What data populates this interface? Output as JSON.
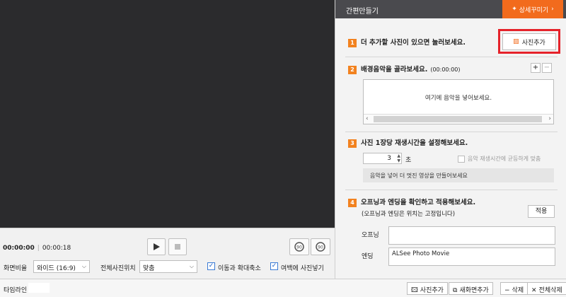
{
  "player": {
    "current_time": "00:00:00",
    "total_time": "00:00:18"
  },
  "options": {
    "aspect_label": "화면비율",
    "aspect_value": "와이드 (16:9)",
    "position_label": "전체사진위치",
    "position_value": "맞춤",
    "zoom_label": "이동과 확대축소",
    "zoom_checked": true,
    "margin_label": "여백에 사진넣기",
    "margin_checked": true
  },
  "timeline": {
    "label": "타임라인",
    "add_photo": "사진추가",
    "add_scene": "새화면추가",
    "delete": "삭제",
    "delete_all": "전체삭제"
  },
  "panel": {
    "title": "간편만들기",
    "detail_button": "상세꾸미기",
    "step1": {
      "num": "1",
      "text": "더 추가할 사진이 있으면 눌러보세요.",
      "button": "사진추가"
    },
    "step2": {
      "num": "2",
      "text": "배경음악을 골라보세요.",
      "time": "(00:00:00)",
      "plus": "+",
      "minus": "−",
      "hint": "여기에 음악을 넣어보세요."
    },
    "step3": {
      "num": "3",
      "text": "사진 1장당 재생시간을 설정해보세요.",
      "value": "3",
      "unit": "초",
      "even_label": "음악 재생시간에 균등하게 맞춤",
      "note": "음악을 넣어 더 멋진 영상을 만들어보세요"
    },
    "step4": {
      "num": "4",
      "text": "오프닝과 엔딩을 확인하고 적용해보세요.",
      "sub": "(오프닝과 엔딩은 위치는 고정입니다)",
      "apply": "적용",
      "opening_label": "오프닝",
      "opening_value": "",
      "ending_label": "엔딩",
      "ending_value": "ALSee Photo Movie"
    }
  },
  "colors": {
    "accent": "#f26b1d",
    "step_badge": "#f2821f",
    "highlight": "#e5222a",
    "preview_bg": "#2b2b2d"
  }
}
